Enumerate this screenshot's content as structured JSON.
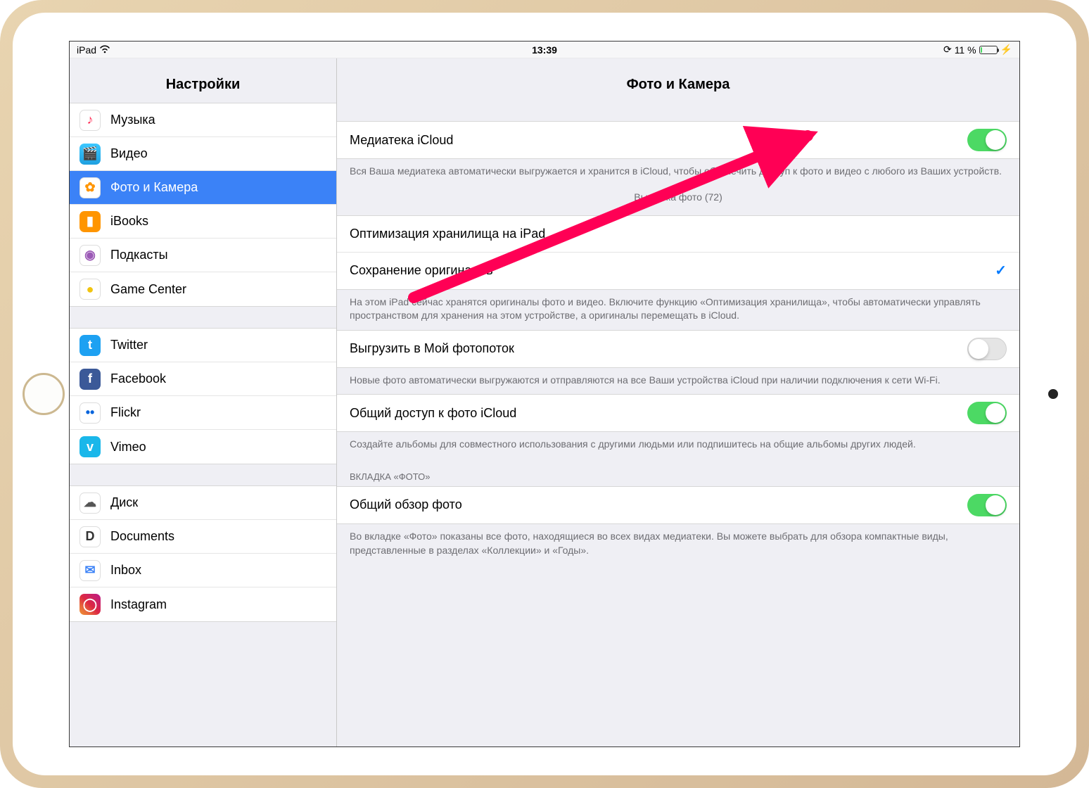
{
  "status": {
    "device": "iPad",
    "time": "13:39",
    "battery_pct": "11 %"
  },
  "sidebar": {
    "title": "Настройки",
    "groups": [
      [
        {
          "label": "Музыка",
          "icon_bg": "#fff",
          "glyph": "♪",
          "glyph_color": "#ff2d55"
        },
        {
          "label": "Видео",
          "icon_bg": "linear-gradient(#3cc8ff,#1fa0e0)",
          "glyph": "🎬",
          "glyph_color": "#fff"
        },
        {
          "label": "Фото и Камера",
          "icon_bg": "#fff",
          "glyph": "✿",
          "glyph_color": "#ff9500",
          "selected": true
        },
        {
          "label": "iBooks",
          "icon_bg": "#ff9500",
          "glyph": "▮",
          "glyph_color": "#fff"
        },
        {
          "label": "Подкасты",
          "icon_bg": "#fff",
          "glyph": "◉",
          "glyph_color": "#9b59b6"
        },
        {
          "label": "Game Center",
          "icon_bg": "#fff",
          "glyph": "●",
          "glyph_color": "#f1c40f"
        }
      ],
      [
        {
          "label": "Twitter",
          "icon_bg": "#1da1f2",
          "glyph": "t",
          "glyph_color": "#fff"
        },
        {
          "label": "Facebook",
          "icon_bg": "#3b5998",
          "glyph": "f",
          "glyph_color": "#fff"
        },
        {
          "label": "Flickr",
          "icon_bg": "#fff",
          "glyph": "••",
          "glyph_color": "#0063dc"
        },
        {
          "label": "Vimeo",
          "icon_bg": "#1ab7ea",
          "glyph": "v",
          "glyph_color": "#fff"
        }
      ],
      [
        {
          "label": "Диск",
          "icon_bg": "#fff",
          "glyph": "☁",
          "glyph_color": "#555"
        },
        {
          "label": "Documents",
          "icon_bg": "#fff",
          "glyph": "D",
          "glyph_color": "#333"
        },
        {
          "label": "Inbox",
          "icon_bg": "#fff",
          "glyph": "✉",
          "glyph_color": "#3b82f7"
        },
        {
          "label": "Instagram",
          "icon_bg": "linear-gradient(45deg,#f09433,#e6683c,#dc2743,#cc2366,#bc1888)",
          "glyph": "◯",
          "glyph_color": "#fff"
        }
      ]
    ]
  },
  "main": {
    "title": "Фото и Камера",
    "groups": [
      {
        "rows": [
          {
            "label": "Медиатека iCloud",
            "type": "toggle",
            "on": true
          }
        ],
        "footer": "Вся Ваша медиатека автоматически выгружается и хранится в iCloud, чтобы обеспечить доступ к фото и видео с любого из Ваших устройств.",
        "status": "Выгрузка фото (72)"
      },
      {
        "rows": [
          {
            "label": "Оптимизация хранилища на iPad",
            "type": "check",
            "checked": false
          },
          {
            "label": "Сохранение оригиналов",
            "type": "check",
            "checked": true
          }
        ],
        "footer": "На этом iPad сейчас хранятся оригиналы фото и видео. Включите функцию «Оптимизация хранилища», чтобы автоматически управлять пространством для хранения на этом устройстве, а оригиналы перемещать в iCloud."
      },
      {
        "rows": [
          {
            "label": "Выгрузить в Мой фотопоток",
            "type": "toggle",
            "on": false
          }
        ],
        "footer": "Новые фото автоматически выгружаются и отправляются на все Ваши устройства iCloud при наличии подключения к сети Wi-Fi."
      },
      {
        "rows": [
          {
            "label": "Общий доступ к фото iCloud",
            "type": "toggle",
            "on": true
          }
        ],
        "footer": "Создайте альбомы для совместного использования с другими людьми или подпишитесь на общие альбомы других людей."
      },
      {
        "header": "ВКЛАДКА «ФОТО»",
        "rows": [
          {
            "label": "Общий обзор фото",
            "type": "toggle",
            "on": true
          }
        ],
        "footer": "Во вкладке «Фото» показаны все фото, находящиеся во всех видах медиатеки. Вы можете выбрать для обзора компактные виды, представленные в разделах «Коллекции» и «Годы»."
      }
    ]
  }
}
